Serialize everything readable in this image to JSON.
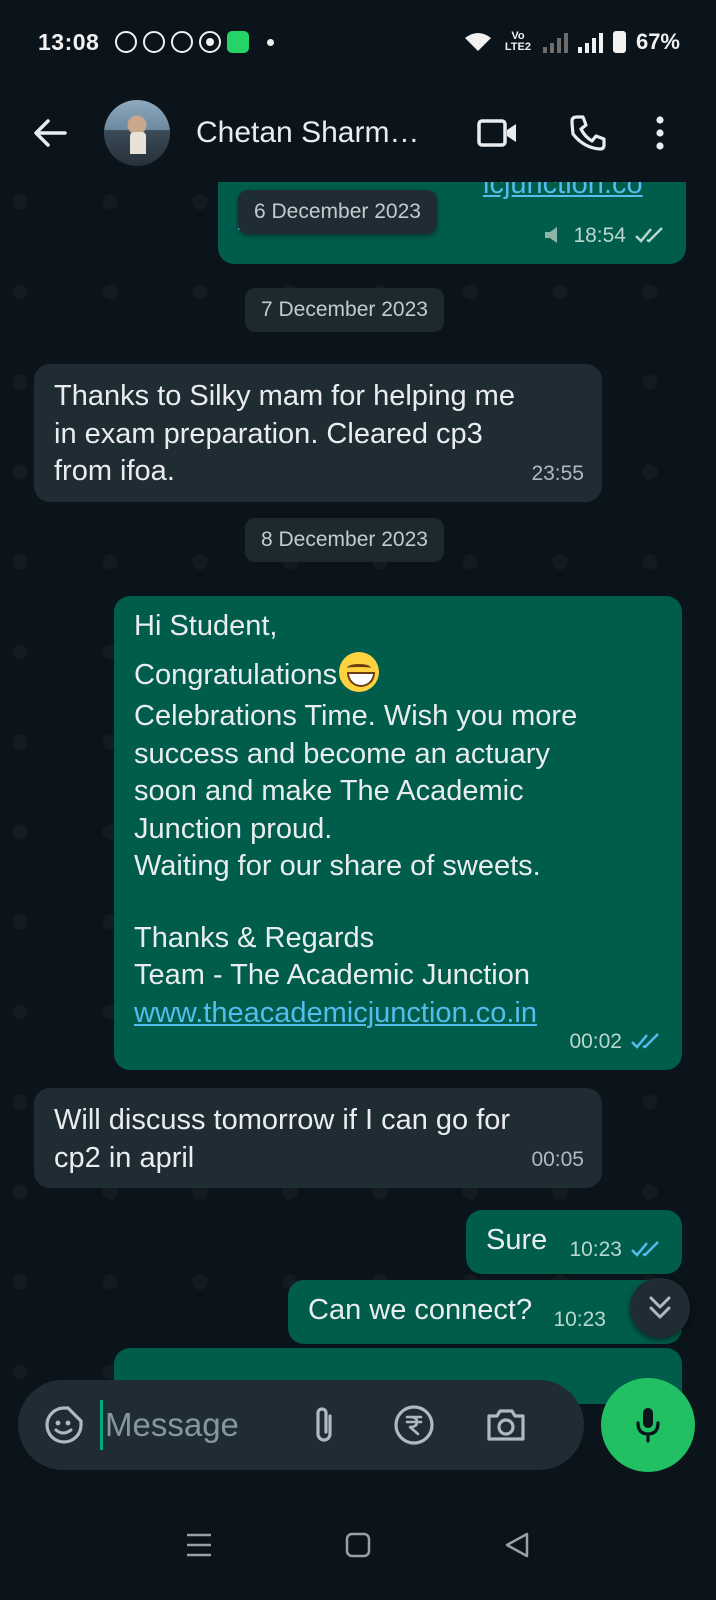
{
  "status_bar": {
    "time": "13:08",
    "network_label": "Vo LTE2",
    "battery": "67%",
    "notification_icons": [
      "whatsapp-icon",
      "whatsapp-icon",
      "whatsapp-icon",
      "facebook-messenger-icon",
      "app-icon"
    ]
  },
  "header": {
    "contact_name": "Chetan Sharm…",
    "icons": [
      "back-arrow-icon",
      "video-call-icon",
      "phone-icon",
      "more-vertical-icon"
    ]
  },
  "chat": {
    "top_partial": {
      "link_fragment": "icjunction.co",
      "link_line2": "...",
      "time": "18:54"
    },
    "floating_date": "6 December 2023",
    "date_1": "7 December 2023",
    "msg_1": {
      "lines": [
        "Thanks to Silky mam for helping me",
        "in exam preparation. Cleared cp3",
        "from ifoa."
      ],
      "time": "23:55"
    },
    "date_2": "8 December 2023",
    "msg_2": {
      "line1": "Hi Student,",
      "line2": "Congratulations",
      "body": [
        "Celebrations Time. Wish you more",
        "success and become an actuary",
        "soon and make The Academic",
        "Junction proud.",
        "Waiting for our share of sweets."
      ],
      "sign1": "Thanks & Regards",
      "sign2": "Team - The Academic Junction",
      "link": "www.theacademicjunction.co.in",
      "time": "00:02"
    },
    "msg_3": {
      "lines": [
        "Will discuss tomorrow if I can go for",
        "cp2 in april"
      ],
      "time": "00:05"
    },
    "msg_4": {
      "text": "Sure",
      "time": "10:23"
    },
    "msg_5": {
      "text": "Can we connect?",
      "time": "10:23"
    }
  },
  "input": {
    "placeholder": "Message"
  },
  "colors": {
    "background": "#0b141a",
    "incoming_bubble": "#202c33",
    "outgoing_bubble": "#005c4b",
    "link": "#53bdeb",
    "read_ticks": "#53bdeb",
    "mic_button": "#21c063"
  }
}
